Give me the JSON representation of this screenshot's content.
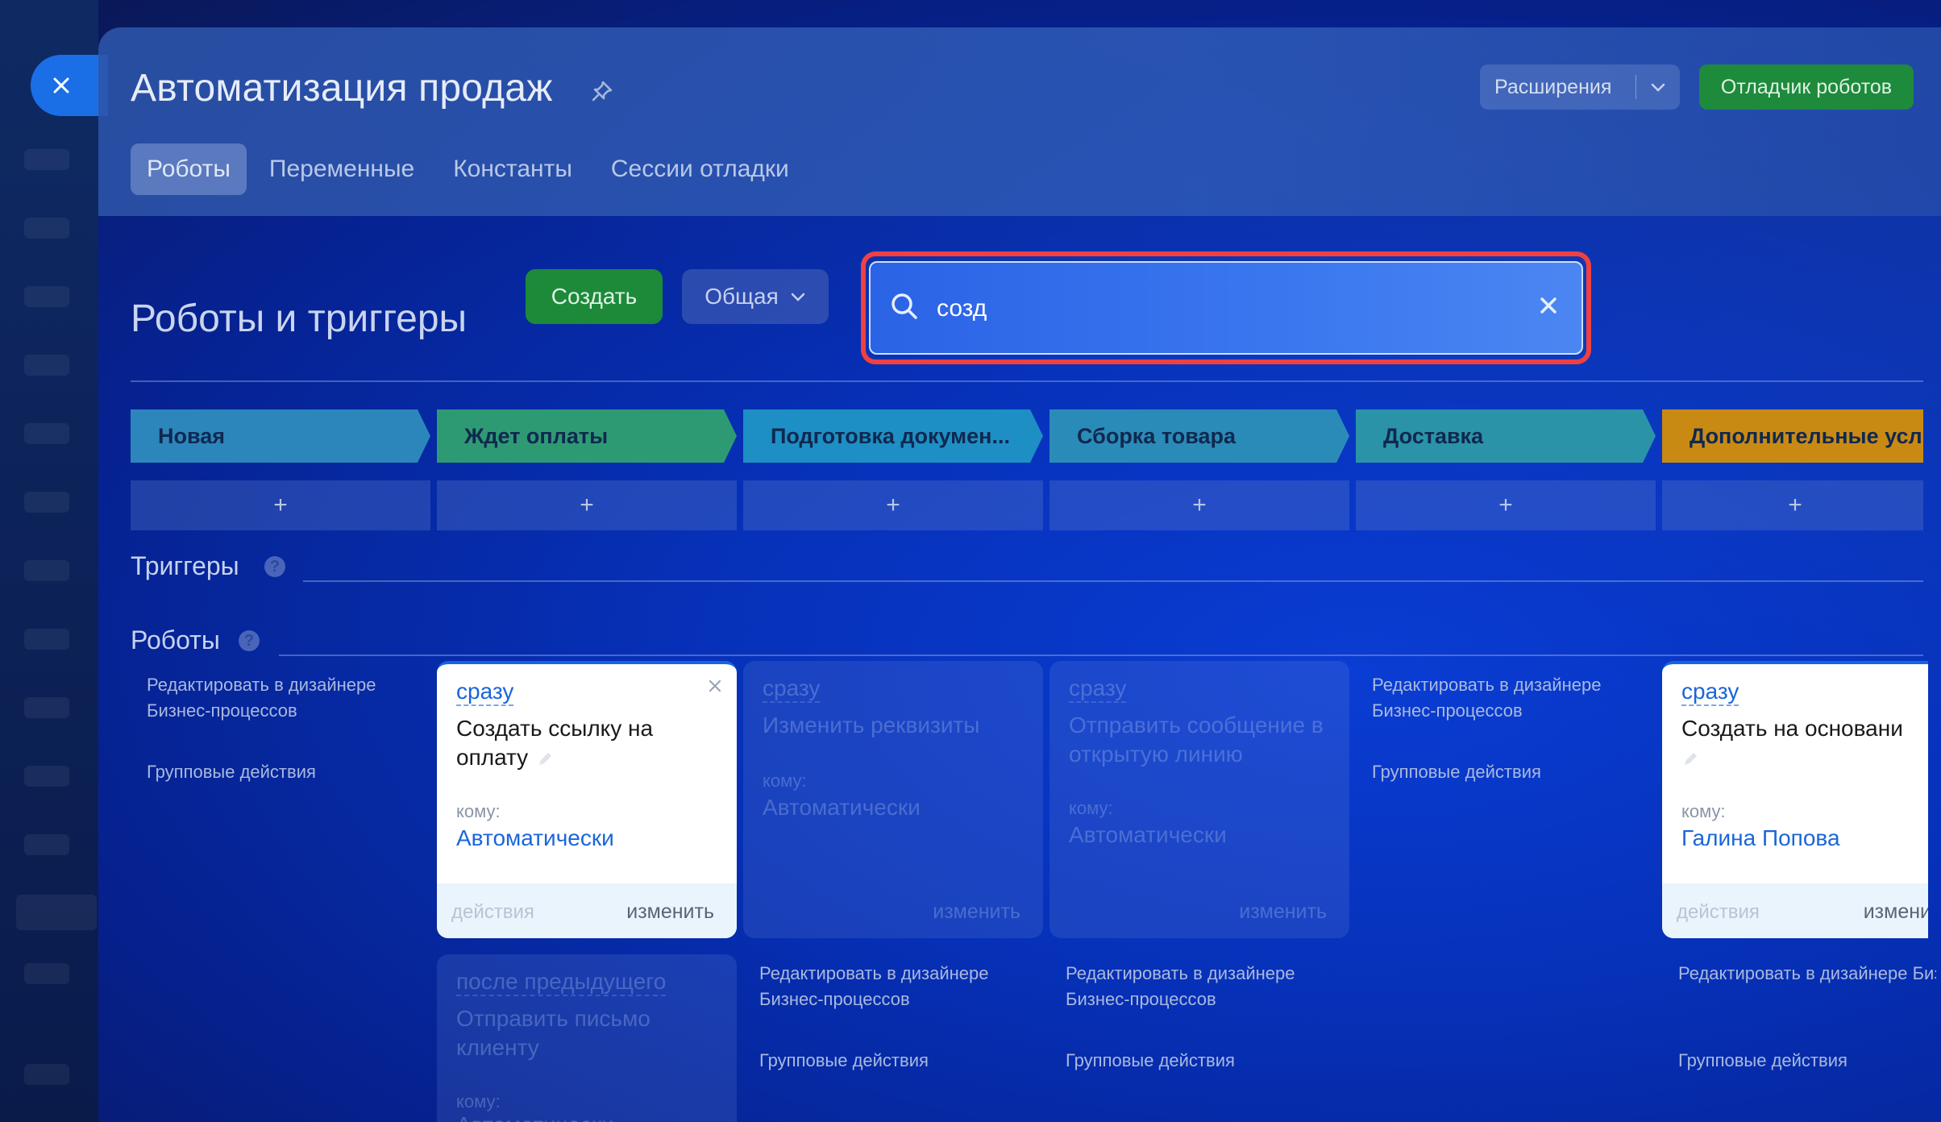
{
  "header": {
    "title": "Автоматизация продаж",
    "extensions_label": "Расширения",
    "debugger_label": "Отладчик роботов",
    "tabs": [
      {
        "label": "Роботы"
      },
      {
        "label": "Переменные"
      },
      {
        "label": "Константы"
      },
      {
        "label": "Сессии отладки"
      }
    ]
  },
  "toolbar": {
    "section_title": "Роботы и триггеры",
    "create_label": "Создать",
    "general_label": "Общая",
    "search_value": "созд"
  },
  "stages": [
    {
      "label": "Новая",
      "color": "#2c86bb"
    },
    {
      "label": "Ждет оплаты",
      "color": "#2e9a73"
    },
    {
      "label": "Подготовка докумен...",
      "color": "#1d8fc4"
    },
    {
      "label": "Сборка товара",
      "color": "#2b8bb8"
    },
    {
      "label": "Доставка",
      "color": "#2a93a8"
    },
    {
      "label": "Дополнительные усл",
      "color": "#c98a14"
    }
  ],
  "add_symbol": "+",
  "triggers_label": "Триггеры",
  "robots_label": "Роботы",
  "help_symbol": "?",
  "side_links": {
    "edit_in_designer": "Редактировать в дизайнере Бизнес-процессов",
    "group_actions": "Групповые действия"
  },
  "cards": [
    {
      "when": "сразу",
      "title": "Создать ссылку на оплату",
      "whom_label": "кому:",
      "who": "Автоматически",
      "actions": "действия",
      "edit": "изменить"
    },
    {
      "when": "сразу",
      "title": "Изменить реквизиты",
      "whom_label": "кому:",
      "who": "Автоматически",
      "edit": "изменить"
    },
    {
      "when": "сразу",
      "title": "Отправить сообщение в открытую линию",
      "whom_label": "кому:",
      "who": "Автоматически",
      "edit": "изменить"
    },
    {
      "when": "сразу",
      "title": "Создать на основани",
      "whom_label": "кому:",
      "who": "Галина Попова",
      "actions": "действия",
      "edit": "измени"
    },
    {
      "when": "после предыдущего",
      "title": "Отправить письмо клиенту",
      "whom_label": "кому:",
      "who": "Автоматически"
    }
  ],
  "colors": {
    "accent_blue": "#1664e6",
    "green_button": "#1d8a3a",
    "search_outline": "#f04040"
  }
}
